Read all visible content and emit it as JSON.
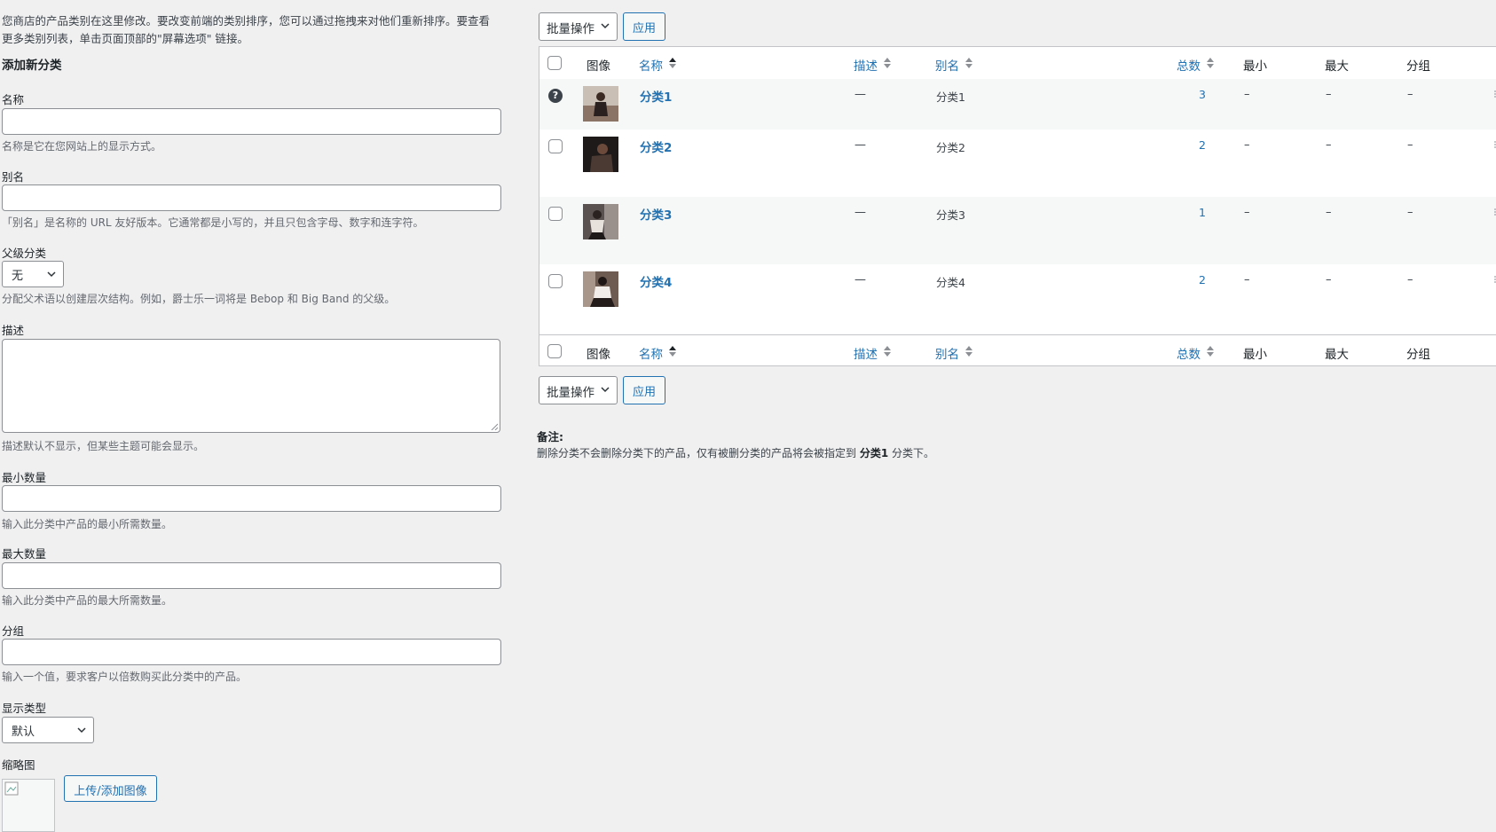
{
  "intro": "您商店的产品类别在这里修改。要改变前端的类别排序，您可以通过拖拽来对他们重新排序。要查看更多类别列表，单击页面顶部的\"屏幕选项\" 链接。",
  "form": {
    "title": "添加新分类",
    "name_label": "名称",
    "name_desc": "名称是它在您网站上的显示方式。",
    "slug_label": "别名",
    "slug_desc": "「别名」是名称的 URL 友好版本。它通常都是小写的，并且只包含字母、数字和连字符。",
    "parent_label": "父级分类",
    "parent_value": "无",
    "parent_desc": "分配父术语以创建层次结构。例如，爵士乐一词将是 Bebop 和 Big Band 的父级。",
    "description_label": "描述",
    "description_desc": "描述默认不显示，但某些主题可能会显示。",
    "min_label": "最小数量",
    "min_desc": "输入此分类中产品的最小所需数量。",
    "max_label": "最大数量",
    "max_desc": "输入此分类中产品的最大所需数量。",
    "group_label": "分组",
    "group_desc": "输入一个值，要求客户以倍数购买此分类中的产品。",
    "display_type_label": "显示类型",
    "display_type_value": "默认",
    "thumbnail_label": "缩略图",
    "upload_button": "上传/添加图像"
  },
  "bulk": {
    "select_label": "批量操作",
    "apply_label": "应用"
  },
  "table": {
    "headers": {
      "image": "图像",
      "name": "名称",
      "description": "描述",
      "slug": "别名",
      "count": "总数",
      "min": "最小",
      "max": "最大",
      "group": "分组"
    },
    "rows": [
      {
        "name": "分类1",
        "description": "—",
        "slug": "分类1",
        "count": "3",
        "min": "–",
        "max": "–",
        "group": "–"
      },
      {
        "name": "分类2",
        "description": "—",
        "slug": "分类2",
        "count": "2",
        "min": "–",
        "max": "–",
        "group": "–"
      },
      {
        "name": "分类3",
        "description": "—",
        "slug": "分类3",
        "count": "1",
        "min": "–",
        "max": "–",
        "group": "–"
      },
      {
        "name": "分类4",
        "description": "—",
        "slug": "分类4",
        "count": "2",
        "min": "–",
        "max": "–",
        "group": "–"
      }
    ],
    "help_icon": "?"
  },
  "note": {
    "title": "备注:",
    "text_before": "删除分类不会删除分类下的产品，仅有被删分类的产品将会被指定到",
    "default_category": "分类1",
    "text_after": "分类下。"
  },
  "icons": [
    "chevron-down-icon",
    "sort-arrows-icon",
    "help-icon",
    "drag-handle-icon",
    "broken-image-icon",
    "resize-handle-icon"
  ],
  "colors": {
    "link": "#2271b1",
    "background": "#f0f0f1",
    "border": "#8c8f94"
  }
}
